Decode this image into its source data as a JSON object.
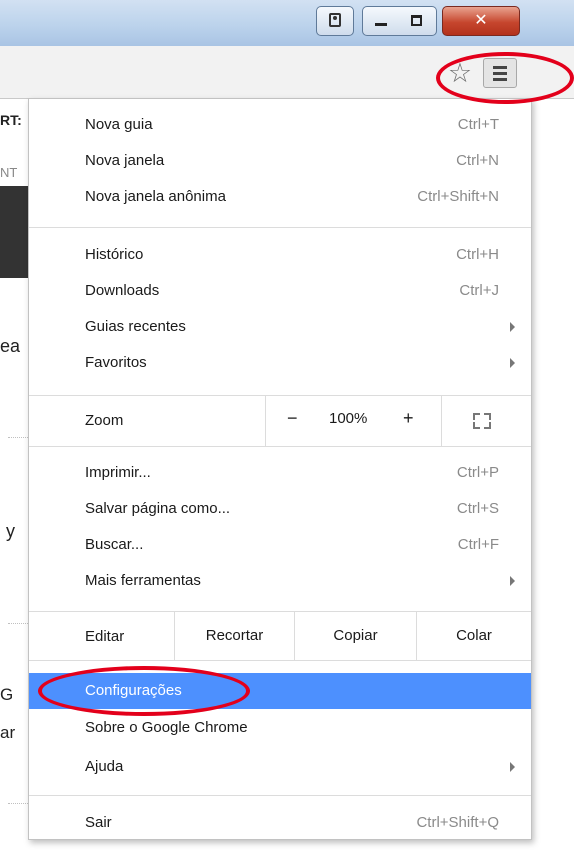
{
  "page_fragments": {
    "top": "RT:",
    "second": "NT",
    "ea": "ea",
    "y": "y",
    "g": "G",
    "ar": "ar"
  },
  "menu": {
    "groups": [
      [
        {
          "label": "Nova guia",
          "shortcut": "Ctrl+T"
        },
        {
          "label": "Nova janela",
          "shortcut": "Ctrl+N"
        },
        {
          "label": "Nova janela anônima",
          "shortcut": "Ctrl+Shift+N"
        }
      ],
      [
        {
          "label": "Histórico",
          "shortcut": "Ctrl+H"
        },
        {
          "label": "Downloads",
          "shortcut": "Ctrl+J"
        },
        {
          "label": "Guias recentes",
          "submenu": true
        },
        {
          "label": "Favoritos",
          "submenu": true
        }
      ],
      [
        {
          "label": "Imprimir...",
          "shortcut": "Ctrl+P"
        },
        {
          "label": "Salvar página como...",
          "shortcut": "Ctrl+S"
        },
        {
          "label": "Buscar...",
          "shortcut": "Ctrl+F"
        },
        {
          "label": "Mais ferramentas",
          "submenu": true
        }
      ],
      [
        {
          "label": "Configurações",
          "selected": true
        },
        {
          "label": "Sobre o Google Chrome"
        },
        {
          "label": "Ajuda",
          "submenu": true
        }
      ],
      [
        {
          "label": "Sair",
          "shortcut": "Ctrl+Shift+Q"
        }
      ]
    ],
    "zoom": {
      "label": "Zoom",
      "minus": "−",
      "value": "100%",
      "plus": "+"
    },
    "edit": {
      "label": "Editar",
      "cut": "Recortar",
      "copy": "Copiar",
      "paste": "Colar"
    }
  },
  "colors": {
    "selection": "#4d90fe",
    "annotation": "#e3001b"
  },
  "icons": {
    "star": "bookmark-star-icon",
    "menu": "hamburger-menu-icon"
  }
}
